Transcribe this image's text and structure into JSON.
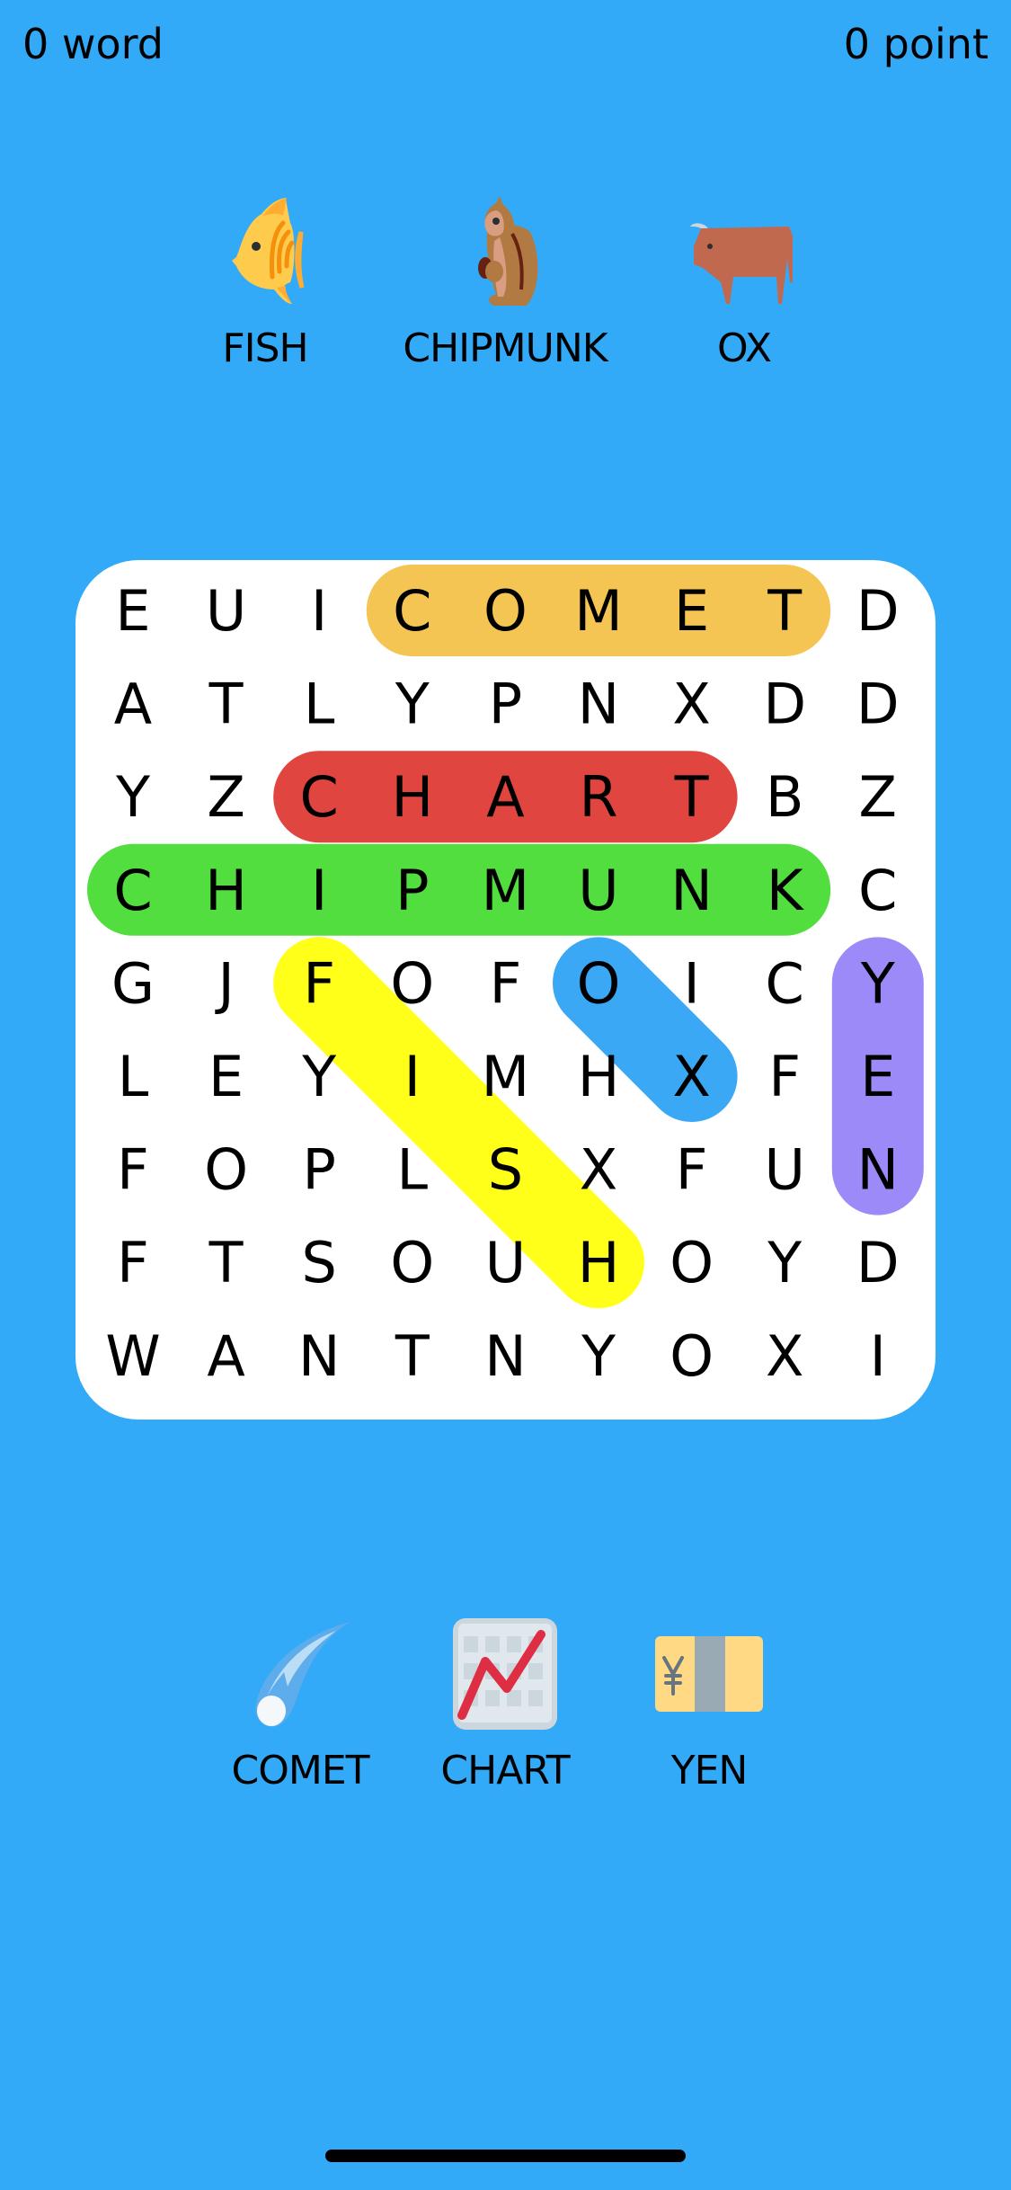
{
  "header": {
    "words_label": "0 word",
    "points_label": "0 point"
  },
  "targets_top": [
    {
      "label": "FISH",
      "icon": "fish-icon"
    },
    {
      "label": "CHIPMUNK",
      "icon": "chipmunk-icon"
    },
    {
      "label": "OX",
      "icon": "ox-icon"
    }
  ],
  "targets_bottom": [
    {
      "label": "COMET",
      "icon": "comet-icon"
    },
    {
      "label": "CHART",
      "icon": "chart-increasing-icon"
    },
    {
      "label": "YEN",
      "icon": "yen-banknote-icon"
    }
  ],
  "grid": [
    "EUICOMETD",
    "ATLYPNXDD",
    "YZCHARTBZ",
    "CHIPMUNKC",
    "GJFOFOICY",
    "LEYIMHXFE",
    "FOPLSXFUN",
    "FTSOUHOYD",
    "WANTNYOXI"
  ],
  "found": [
    {
      "word": "COMET",
      "from": [
        0,
        3
      ],
      "to": [
        0,
        7
      ],
      "color": "#F4C552"
    },
    {
      "word": "CHART",
      "from": [
        2,
        2
      ],
      "to": [
        2,
        6
      ],
      "color": "#E0463F"
    },
    {
      "word": "CHIPMUNK",
      "from": [
        3,
        0
      ],
      "to": [
        3,
        7
      ],
      "color": "#52DE3E"
    },
    {
      "word": "FISH",
      "from": [
        4,
        2
      ],
      "to": [
        7,
        5
      ],
      "color": "#FFFF1A"
    },
    {
      "word": "OX",
      "from": [
        4,
        5
      ],
      "to": [
        5,
        6
      ],
      "color": "#3AA8F5"
    },
    {
      "word": "YEN",
      "from": [
        4,
        8
      ],
      "to": [
        6,
        8
      ],
      "color": "#9B8AF7"
    }
  ],
  "colors": {
    "background": "#33AAF8",
    "card": "#FFFFFF"
  }
}
